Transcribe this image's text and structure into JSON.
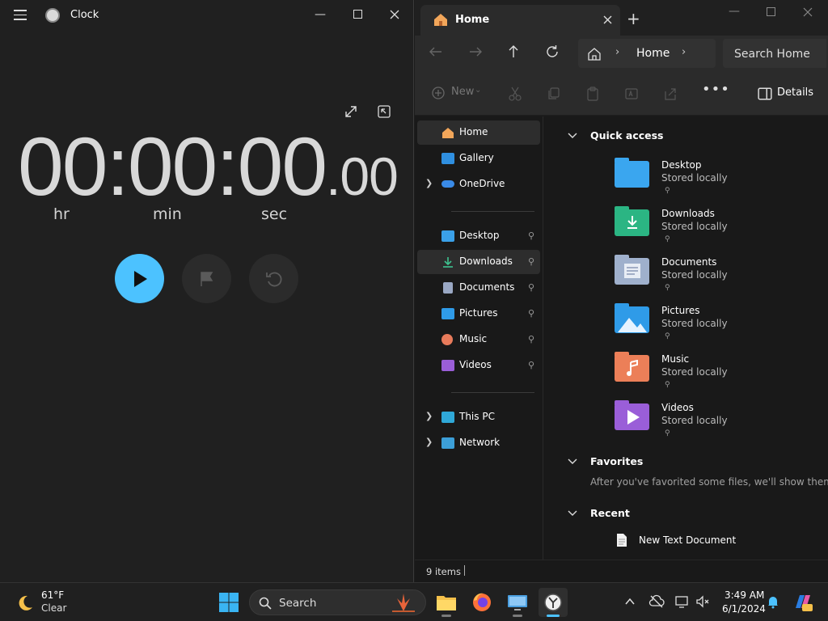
{
  "clock": {
    "title": "Clock",
    "time": {
      "hours": "00",
      "sep1": ":",
      "minutes": "00",
      "sep2": ":",
      "seconds": "00",
      "fraction": ".00"
    },
    "units": {
      "hr": "hr",
      "min": "min",
      "sec": "sec"
    },
    "colors": {
      "play": "#4cc2ff",
      "bg": "#202020"
    }
  },
  "explorer": {
    "tab_title": "Home",
    "breadcrumb": "Home",
    "search_placeholder": "Search Home",
    "toolbar": {
      "new_label": "New",
      "details_label": "Details"
    },
    "sidebar": {
      "items": [
        {
          "label": "Home"
        },
        {
          "label": "Gallery"
        },
        {
          "label": "OneDrive"
        },
        {
          "label": "Desktop"
        },
        {
          "label": "Downloads"
        },
        {
          "label": "Documents"
        },
        {
          "label": "Pictures"
        },
        {
          "label": "Music"
        },
        {
          "label": "Videos"
        },
        {
          "label": "This PC"
        },
        {
          "label": "Network"
        }
      ]
    },
    "sections": {
      "quick_access": "Quick access",
      "favorites": "Favorites",
      "recent": "Recent"
    },
    "quick_access": [
      {
        "name": "Desktop",
        "status": "Stored locally"
      },
      {
        "name": "Downloads",
        "status": "Stored locally"
      },
      {
        "name": "Documents",
        "status": "Stored locally"
      },
      {
        "name": "Pictures",
        "status": "Stored locally"
      },
      {
        "name": "Music",
        "status": "Stored locally"
      },
      {
        "name": "Videos",
        "status": "Stored locally"
      }
    ],
    "favorites_empty": "After you've favorited some files, we'll show them here.",
    "recent": [
      {
        "name": "New Text Document"
      }
    ],
    "status": "9 items"
  },
  "taskbar": {
    "weather": {
      "temp": "61°F",
      "condition": "Clear"
    },
    "search_label": "Search",
    "time": "3:49 AM",
    "date": "6/1/2024"
  }
}
